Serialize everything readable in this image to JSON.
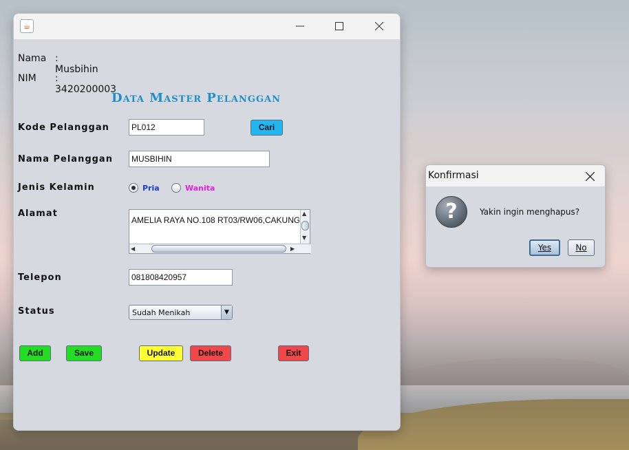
{
  "window": {
    "app_icon": "java-cup-icon"
  },
  "info": {
    "nama_label": "Nama",
    "nama_value": ": Musbihin",
    "nim_label": "NIM",
    "nim_value": ": 3420200003"
  },
  "form": {
    "title": "Data Master Pelanggan",
    "kode_label": "Kode Pelanggan",
    "kode_value": "PL012",
    "cari_label": "Cari",
    "nama_label": "Nama Pelanggan",
    "nama_value": "MUSBIHIN",
    "jenis_label": "Jenis Kelamin",
    "pria_label": "Pria",
    "wanita_label": "Wanita",
    "selected_gender": "Pria",
    "alamat_label": "Alamat",
    "alamat_value": "AMELIA RAYA NO.108 RT03/RW06,CAKUNG",
    "telepon_label": "Telepon",
    "telepon_value": "081808420957",
    "status_label": "Status",
    "status_value": "Sudah Menikah"
  },
  "buttons": {
    "add": "Add",
    "save": "Save",
    "update": "Update",
    "delete": "Delete",
    "exit": "Exit"
  },
  "colors": {
    "green": "#22dd22",
    "yellow": "#ffff33",
    "red": "#f04848",
    "cari_blue": "#23b7f2",
    "title_blue": "#1e8ec8",
    "pria_color": "#1a3ccf",
    "wanita_color": "#e81ee0"
  },
  "dialog": {
    "title": "Konfirmasi",
    "icon": "question-icon",
    "message": "Yakin ingin menghapus?",
    "yes": "Yes",
    "no": "No"
  }
}
